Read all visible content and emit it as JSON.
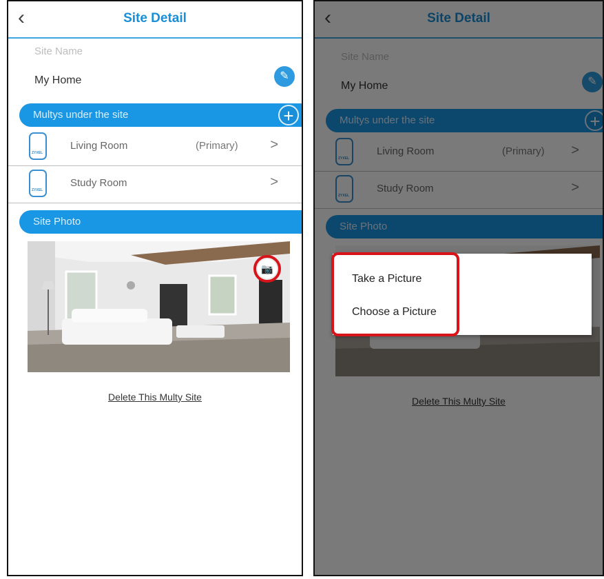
{
  "header": {
    "title": "Site Detail",
    "back_icon": "‹"
  },
  "site": {
    "name_label": "Site Name",
    "name_value": "My Home"
  },
  "multys": {
    "section_label": "Multys under the site",
    "items": [
      {
        "room": "Living Room",
        "role": "(Primary)",
        "device_brand": "ZYXEL"
      },
      {
        "room": "Study Room",
        "role": "",
        "device_brand": "ZYXEL"
      }
    ]
  },
  "photo": {
    "section_label": "Site Photo"
  },
  "delete_label": "Delete This Multy Site",
  "picture_menu": {
    "options": [
      "Take a Picture",
      "Choose a Picture"
    ]
  },
  "colors": {
    "accent": "#1996e4",
    "title": "#1a8fd8",
    "highlight": "#d8141a"
  },
  "icons": {
    "back": "chevron-left-icon",
    "edit": "edit-icon",
    "add": "plus-icon",
    "camera": "camera-icon",
    "arrow": "chevron-right-icon"
  }
}
